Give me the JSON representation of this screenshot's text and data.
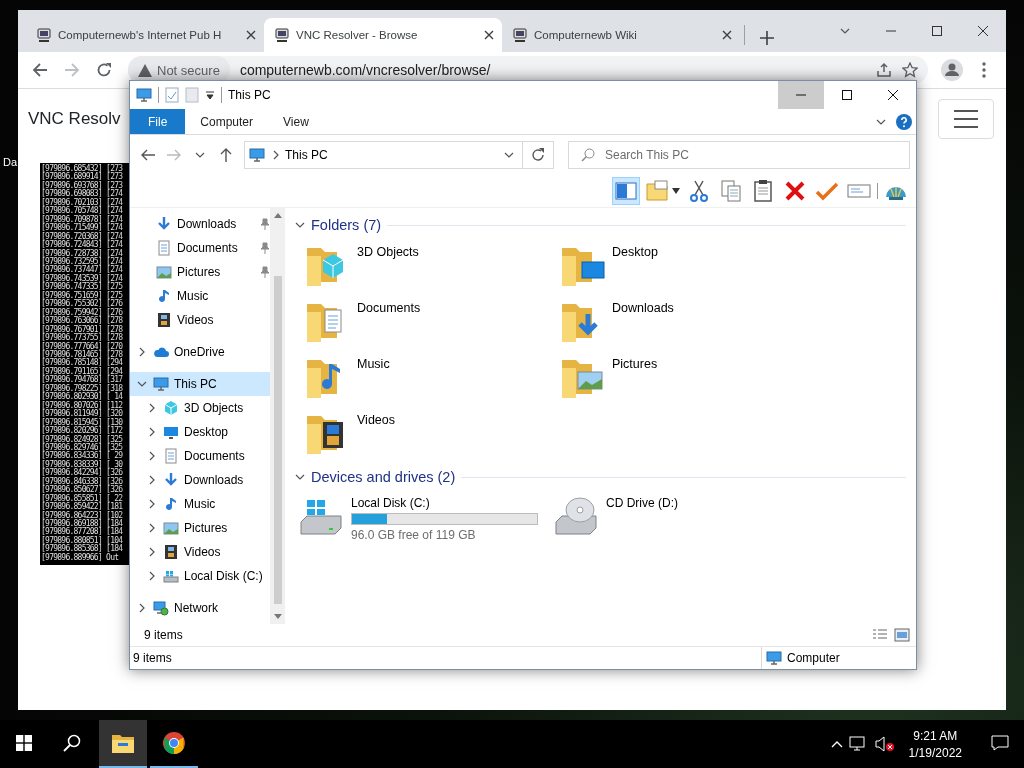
{
  "desktop": {
    "label": "Da"
  },
  "browser": {
    "tabs": [
      {
        "title": "Computernewb's Internet Pub H",
        "selected": false
      },
      {
        "title": "VNC Resolver - Browse",
        "selected": true
      },
      {
        "title": "Computernewb Wiki",
        "selected": false
      }
    ],
    "omnibox": {
      "security": "Not secure",
      "url": "computernewb.com/vncresolver/browse/"
    },
    "page": {
      "title": "VNC Resolv",
      "terminal_lines": [
        "[979896.685432] [273",
        "[979896.689914] [273",
        "[979896.693768] [273",
        "[979896.698083] [274",
        "[979896.702103] [274",
        "[979896.705748] [274",
        "[979896.709878] [274",
        "[979896.715499] [274",
        "[979896.720368] [274",
        "[979896.724843] [274",
        "[979896.728738] [274",
        "[979896.732595] [274",
        "[979896.737447] [274",
        "[979896.743539] [274",
        "[979896.747335] [275",
        "[979896.751659] [275",
        "[979896.755302] [276",
        "[979896.759942] [276",
        "[979896.763066] [278",
        "[979896.767901] [278",
        "[979896.773755] [278",
        "[979896.777664] [270",
        "[979896.781465] [278",
        "[979896.785148] [294",
        "[979896.791165] [294",
        "[979896.794768] [317",
        "[979896.798225] [318",
        "[979896.802930] [ 14",
        "[979896.807026] [112",
        "[979896.811949] [320",
        "[979896.815945] [130",
        "[979896.820296] [172",
        "[979896.824928] [325",
        "[979896.829746] [325",
        "[979896.834336] [ 29",
        "[979896.838339] [ 30",
        "[979896.842294] [326",
        "[979896.846338] [326",
        "[979896.850627] [326",
        "[979896.855851] [ 22",
        "[979896.859422] [181",
        "[979896.864223] [102",
        "[979896.869188] [184",
        "[979896.877208] [184",
        "[979896.880851] [104",
        "[979896.885368] [184",
        "[979896.889966] Out"
      ]
    }
  },
  "explorer": {
    "title": "This PC",
    "window_buttons": [
      {
        "kind": "minimize",
        "highlighted": true
      },
      {
        "kind": "maximize",
        "highlighted": false
      },
      {
        "kind": "close",
        "highlighted": false
      }
    ],
    "ribbon_tabs": [
      {
        "label": "File",
        "selected": true
      },
      {
        "label": "Computer",
        "selected": false
      },
      {
        "label": "View",
        "selected": false
      }
    ],
    "address": {
      "location": "This PC"
    },
    "search": {
      "placeholder": "Search This PC"
    },
    "toolbar": [
      {
        "kind": "preview-pane",
        "selected": true
      },
      {
        "kind": "new-folder",
        "selected": false
      },
      {
        "kind": "cut",
        "selected": false
      },
      {
        "kind": "copy",
        "selected": false
      },
      {
        "kind": "paste",
        "selected": false
      },
      {
        "kind": "delete",
        "selected": false
      },
      {
        "kind": "check",
        "selected": false
      },
      {
        "kind": "rename",
        "selected": false
      },
      {
        "kind": "shell",
        "selected": false
      }
    ],
    "navigation_pane": {
      "quick_access": [
        {
          "label": "Downloads",
          "kind": "download",
          "pinned": true
        },
        {
          "label": "Documents",
          "kind": "documents",
          "pinned": true
        },
        {
          "label": "Pictures",
          "kind": "pictures",
          "pinned": true
        },
        {
          "label": "Music",
          "kind": "music",
          "pinned": false
        },
        {
          "label": "Videos",
          "kind": "videos",
          "pinned": false
        }
      ],
      "items": [
        {
          "label": "OneDrive",
          "kind": "cloud",
          "expanded": false,
          "selected": false
        },
        {
          "label": "This PC",
          "kind": "pc",
          "expanded": true,
          "selected": true,
          "children": [
            {
              "label": "3D Objects",
              "kind": "cube",
              "expanded": false,
              "selected": false
            },
            {
              "label": "Desktop",
              "kind": "desktop",
              "expanded": false,
              "selected": false
            },
            {
              "label": "Documents",
              "kind": "documents",
              "expanded": false,
              "selected": false
            },
            {
              "label": "Downloads",
              "kind": "download",
              "expanded": false,
              "selected": false
            },
            {
              "label": "Music",
              "kind": "music",
              "expanded": false,
              "selected": false
            },
            {
              "label": "Pictures",
              "kind": "pictures",
              "expanded": false,
              "selected": false
            },
            {
              "label": "Videos",
              "kind": "videos",
              "expanded": false,
              "selected": false
            },
            {
              "label": "Local Disk (C:)",
              "kind": "drive",
              "expanded": false,
              "selected": false
            }
          ]
        },
        {
          "label": "Network",
          "kind": "network",
          "expanded": false,
          "selected": false
        }
      ]
    },
    "folders": {
      "title": "Folders (7)",
      "expanded": true,
      "items": [
        {
          "name": "3D Objects",
          "kind": "cube"
        },
        {
          "name": "Desktop",
          "kind": "desktop"
        },
        {
          "name": "Documents",
          "kind": "documents"
        },
        {
          "name": "Downloads",
          "kind": "download"
        },
        {
          "name": "Music",
          "kind": "music"
        },
        {
          "name": "Pictures",
          "kind": "pictures"
        },
        {
          "name": "Videos",
          "kind": "videos"
        }
      ]
    },
    "drives": {
      "title": "Devices and drives (2)",
      "expanded": true,
      "items": [
        {
          "name": "Local Disk (C:)",
          "kind": "hdd",
          "level": 0.19,
          "detail": "96.0 GB free of 119 GB"
        },
        {
          "name": "CD Drive (D:)",
          "kind": "cd"
        }
      ]
    },
    "item_count": "9 items",
    "status_bar": {
      "items": "9 items",
      "zone": "Computer"
    }
  },
  "taskbar": {
    "apps": [
      {
        "kind": "explorer",
        "active": true
      },
      {
        "kind": "browser",
        "active": false
      }
    ],
    "time": "9:21 AM",
    "date": "1/19/2022"
  }
}
